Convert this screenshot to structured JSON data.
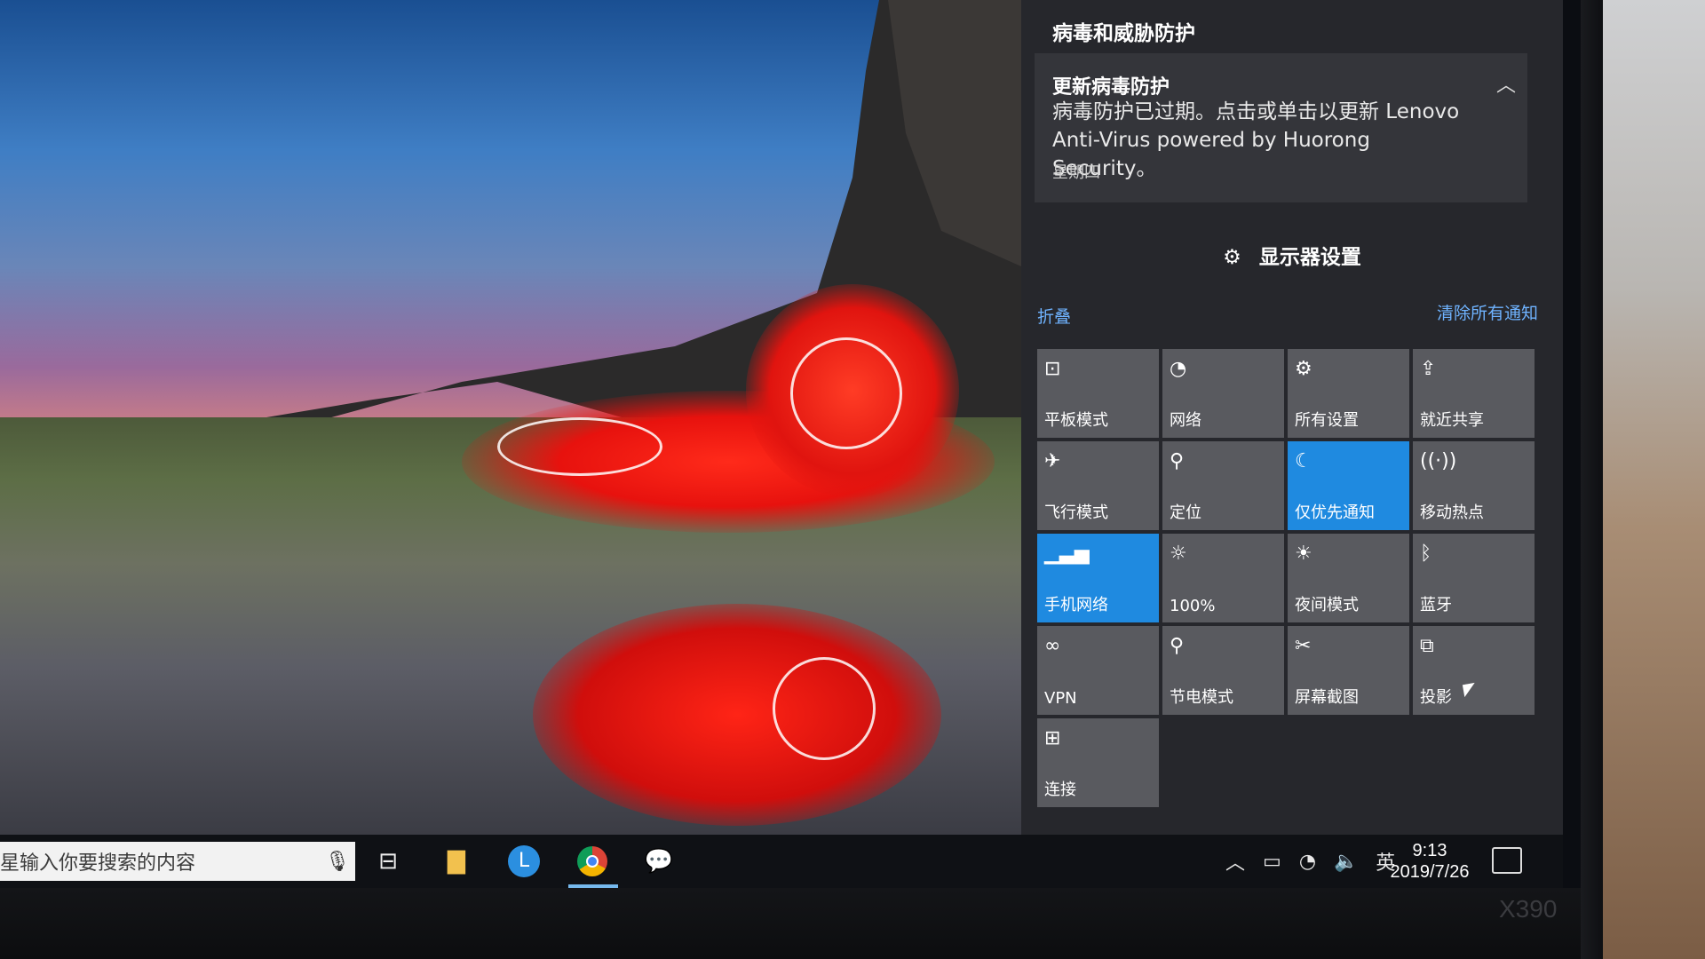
{
  "notification": {
    "group_title": "病毒和威胁防护",
    "title": "更新病毒防护",
    "body": "病毒防护已过期。点击或单击以更新 Lenovo Anti-Virus powered by Huorong Security。",
    "time": "星期四",
    "collapse_icon": "chevron-up-icon"
  },
  "action_center": {
    "display_settings_label": "显示器设置",
    "collapse_label": "折叠",
    "clear_all_label": "清除所有通知",
    "accent": "#1f8ae0",
    "link_color": "#6fb3ff"
  },
  "quick_actions": [
    {
      "label": "平板模式",
      "icon": "tablet-mode-icon",
      "glyph": "⊡",
      "active": false
    },
    {
      "label": "网络",
      "icon": "wifi-icon",
      "glyph": "◔",
      "active": false
    },
    {
      "label": "所有设置",
      "icon": "gear-icon",
      "glyph": "⚙",
      "active": false
    },
    {
      "label": "就近共享",
      "icon": "share-icon",
      "glyph": "⇪",
      "active": false
    },
    {
      "label": "飞行模式",
      "icon": "airplane-icon",
      "glyph": "✈",
      "active": false
    },
    {
      "label": "定位",
      "icon": "location-icon",
      "glyph": "⚲",
      "active": false
    },
    {
      "label": "仅优先通知",
      "icon": "moon-icon",
      "glyph": "☾",
      "active": true
    },
    {
      "label": "移动热点",
      "icon": "hotspot-icon",
      "glyph": "((·))",
      "active": false
    },
    {
      "label": "手机网络",
      "icon": "cellular-icon",
      "glyph": "▁▃▅",
      "active": true
    },
    {
      "label": "100%",
      "icon": "brightness-icon",
      "glyph": "☼",
      "active": false
    },
    {
      "label": "夜间模式",
      "icon": "night-light-icon",
      "glyph": "☀",
      "active": false
    },
    {
      "label": "蓝牙",
      "icon": "bluetooth-icon",
      "glyph": "ᛒ",
      "active": false
    },
    {
      "label": "VPN",
      "icon": "vpn-icon",
      "glyph": "∞",
      "active": false
    },
    {
      "label": "节电模式",
      "icon": "battery-saver-icon",
      "glyph": "⚲",
      "active": false
    },
    {
      "label": "屏幕截图",
      "icon": "screen-snip-icon",
      "glyph": "✂",
      "active": false
    },
    {
      "label": "投影",
      "icon": "project-icon",
      "glyph": "⧉",
      "active": false
    },
    {
      "label": "连接",
      "icon": "connect-icon",
      "glyph": "⊞",
      "active": false
    }
  ],
  "taskbar": {
    "search_placeholder": "星输入你要搜索的内容",
    "ime_label": "英",
    "time": "9:13",
    "date": "2019/7/26"
  },
  "hardware": {
    "model_label": "X390"
  }
}
